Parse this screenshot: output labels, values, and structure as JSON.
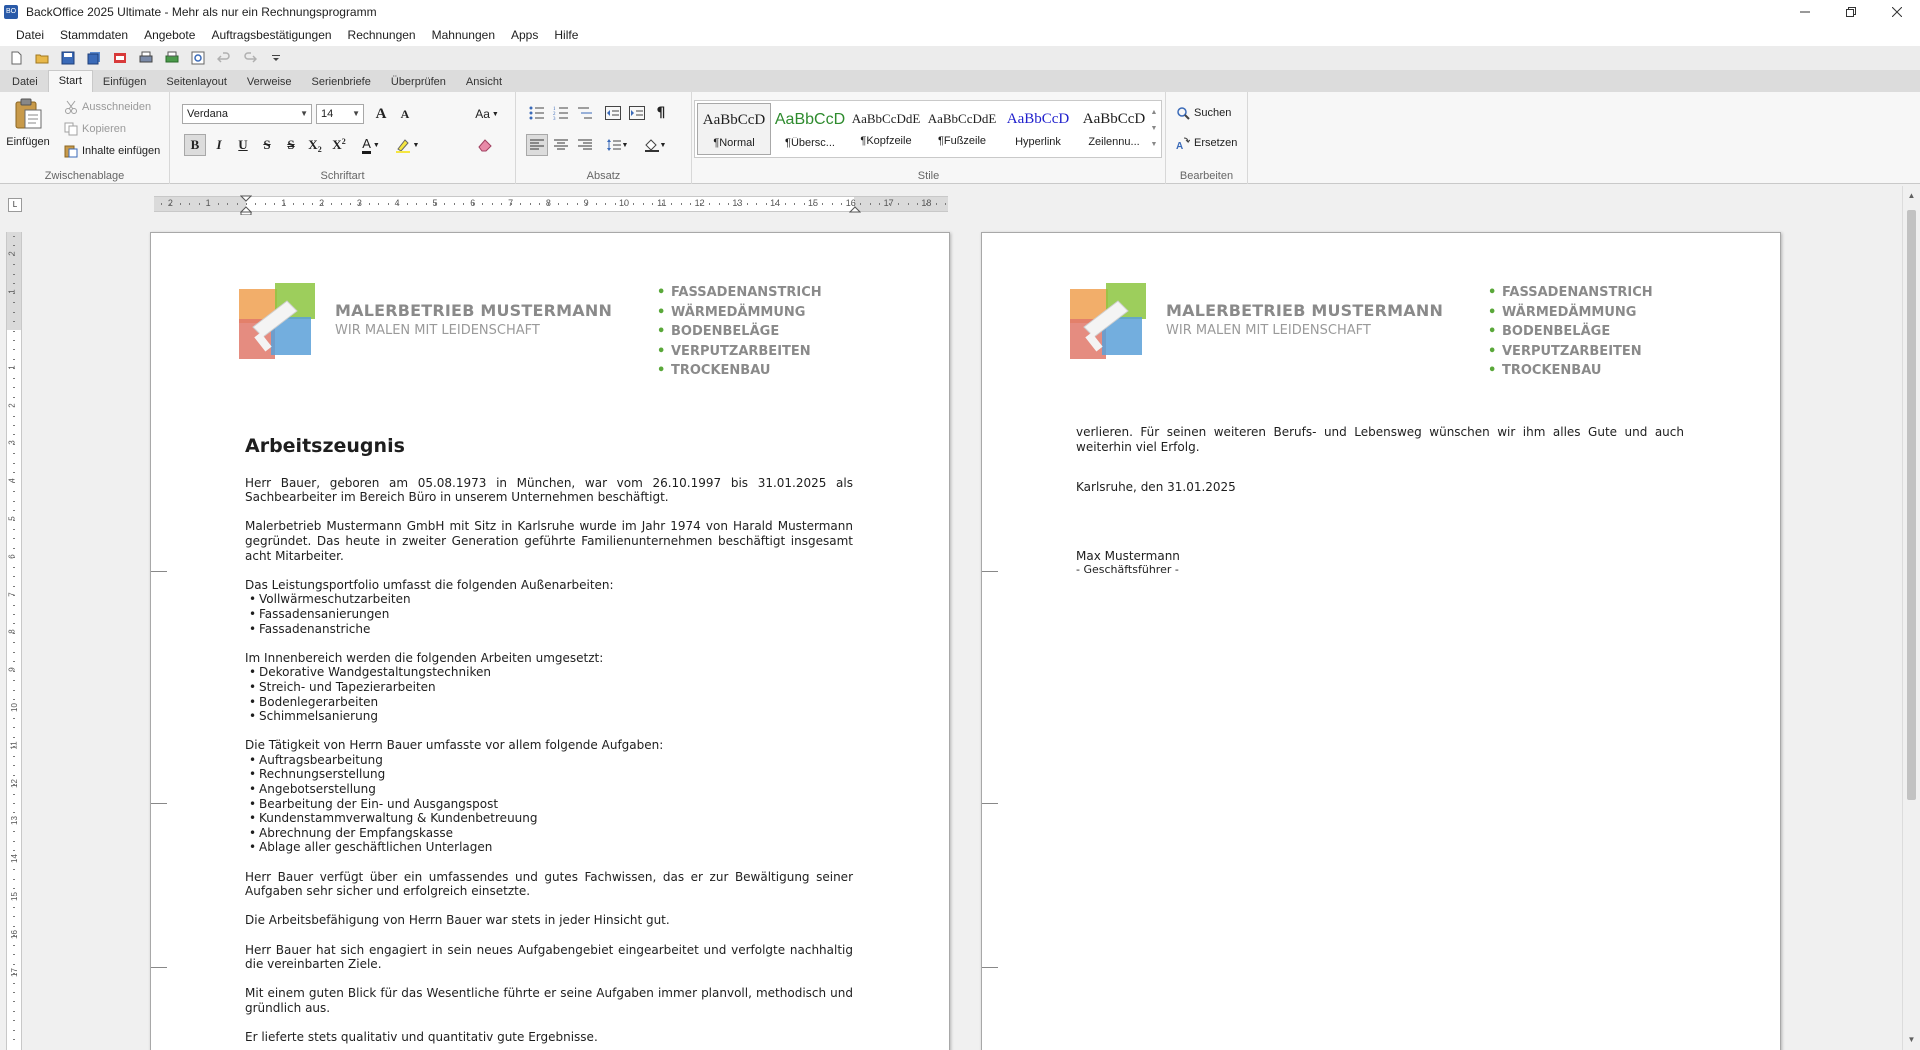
{
  "window": {
    "title": "BackOffice 2025 Ultimate - Mehr als nur ein Rechnungsprogramm",
    "icon_label": "BO",
    "controls": [
      "minimize-icon",
      "restore-icon",
      "close-icon"
    ]
  },
  "menu": {
    "items": [
      "Datei",
      "Stammdaten",
      "Angebote",
      "Auftragsbestätigungen",
      "Rechnungen",
      "Mahnungen",
      "Apps",
      "Hilfe"
    ]
  },
  "quick_access": {
    "icons": [
      "new-document-icon",
      "open-folder-icon",
      "save-icon",
      "save-all-icon",
      "pdf-icon",
      "print-icon",
      "quick-print-icon",
      "print-preview-icon",
      "undo-icon",
      "redo-icon",
      "customize-dropdown-icon"
    ]
  },
  "ribbon": {
    "tabs": [
      "Datei",
      "Start",
      "Einfügen",
      "Seitenlayout",
      "Verweise",
      "Serienbriefe",
      "Überprüfen",
      "Ansicht"
    ],
    "active_tab": "Start",
    "clipboard": {
      "label": "Zwischenablage",
      "paste": "Einfügen",
      "cut": "Ausschneiden",
      "copy": "Kopieren",
      "paste_contents": "Inhalte einfügen"
    },
    "font": {
      "label": "Schriftart",
      "family": "Verdana",
      "size": "14",
      "grow_label": "A",
      "shrink_label": "A",
      "case_label": "Aa",
      "bold": "B",
      "italic": "I",
      "underline": "U",
      "strike": "S",
      "double_strike": "S",
      "subscript": "X",
      "superscript": "X",
      "font_color_label": "A"
    },
    "paragraph": {
      "label": "Absatz",
      "pilcrow": "¶"
    },
    "styles": {
      "label": "Stile",
      "items": [
        {
          "sample": "AaBbCcD",
          "name": "¶Normal",
          "color": "#1e1e1e"
        },
        {
          "sample": "AaBbCcD",
          "name": "¶Übersc...",
          "color": "#2e8b2e"
        },
        {
          "sample": "AaBbCcDdE",
          "name": "¶Kopfzeile",
          "color": "#1e1e1e"
        },
        {
          "sample": "AaBbCcDdE",
          "name": "¶Fußzeile",
          "color": "#1e1e1e"
        },
        {
          "sample": "AaBbCcD",
          "name": "Hyperlink",
          "color": "#1f1fcc"
        },
        {
          "sample": "AaBbCcD",
          "name": "Zeilennu...",
          "color": "#1e1e1e"
        }
      ]
    },
    "editing": {
      "label": "Bearbeiten",
      "find": "Suchen",
      "replace": "Ersetzen"
    }
  },
  "ruler": {
    "corner": "L",
    "numbers": [
      "2",
      "1",
      "1",
      "2",
      "3",
      "4",
      "5",
      "6",
      "7",
      "8",
      "9",
      "10",
      "11",
      "12",
      "13",
      "14",
      "15",
      "16",
      "17",
      "18"
    ]
  },
  "vruler": {
    "numbers": [
      "2",
      "1",
      "1",
      "2",
      "3",
      "4",
      "5",
      "6",
      "7",
      "8",
      "9",
      "10",
      "11",
      "12",
      "13",
      "14",
      "15",
      "16",
      "17"
    ]
  },
  "letterhead": {
    "company": "MALERBETRIEB MUSTERMANN",
    "slogan": "WIR MALEN MIT LEIDENSCHAFT",
    "bullet": "•",
    "services": [
      "FASSADENANSTRICH",
      "WÄRMEDÄMMUNG",
      "BODENBELÄGE",
      "VERPUTZARBEITEN",
      "TROCKENBAU"
    ],
    "colors": {
      "text": "#8a8a8a",
      "bullet": "#5aa83a",
      "logo_red": "#e0786a",
      "logo_green": "#8cc63f",
      "logo_blue": "#5aa0d8",
      "logo_orange": "#f0a050"
    }
  },
  "page1": {
    "title": "Arbeitszeugnis",
    "p1": "Herr Bauer, geboren am 05.08.1973 in München, war vom 26.10.1997 bis 31.01.2025 als Sachbearbeiter im Bereich Büro in unserem Unternehmen beschäftigt.",
    "p2": "Malerbetrieb Mustermann GmbH mit Sitz in Karlsruhe wurde im Jahr 1974 von Harald Mustermann gegründet. Das heute in zweiter Generation geführte Familienunternehmen beschäftigt insgesamt acht Mitarbeiter.",
    "p3_intro": "Das Leistungsportfolio umfasst die folgenden Außenarbeiten:",
    "list1": [
      "Vollwärmeschutzarbeiten",
      "Fassadensanierungen",
      "Fassadenanstriche"
    ],
    "p4_intro": "Im Innenbereich werden die folgenden Arbeiten umgesetzt:",
    "list2": [
      "Dekorative Wandgestaltungstechniken",
      "Streich- und Tapezierarbeiten",
      "Bodenlegerarbeiten",
      "Schimmelsanierung"
    ],
    "p5_intro": "Die Tätigkeit von Herrn Bauer umfasste vor allem folgende Aufgaben:",
    "list3": [
      "Auftragsbearbeitung",
      "Rechnungserstellung",
      "Angebotserstellung",
      "Bearbeitung der Ein- und Ausgangspost",
      "Kundenstammverwaltung & Kundenbetreuung",
      "Abrechnung der Empfangskasse",
      "Ablage aller geschäftlichen Unterlagen"
    ],
    "p6": "Herr Bauer verfügt über ein umfassendes und gutes Fachwissen, das er zur Bewältigung seiner Aufgaben sehr sicher und erfolgreich einsetzte.",
    "p7": "Die Arbeitsbefähigung von Herrn Bauer war stets in jeder Hinsicht gut.",
    "p8": "Herr Bauer hat sich engagiert in sein neues Aufgabengebiet eingearbeitet und verfolgte nachhaltig die vereinbarten Ziele.",
    "p9": "Mit einem guten Blick für das Wesentliche führte er seine Aufgaben immer planvoll, methodisch und gründlich aus.",
    "p10": "Er lieferte stets qualitativ und quantitativ gute Ergebnisse."
  },
  "page2": {
    "p1": "verlieren. Für seinen weiteren Berufs- und Lebensweg wünschen wir ihm alles Gute und auch weiterhin viel Erfolg.",
    "place_date": "Karlsruhe, den 31.01.2025",
    "signer": "Max Mustermann",
    "signer_role": "- Geschäftsführer -"
  },
  "scrollbar": {
    "up": "▲",
    "down": "▼"
  }
}
